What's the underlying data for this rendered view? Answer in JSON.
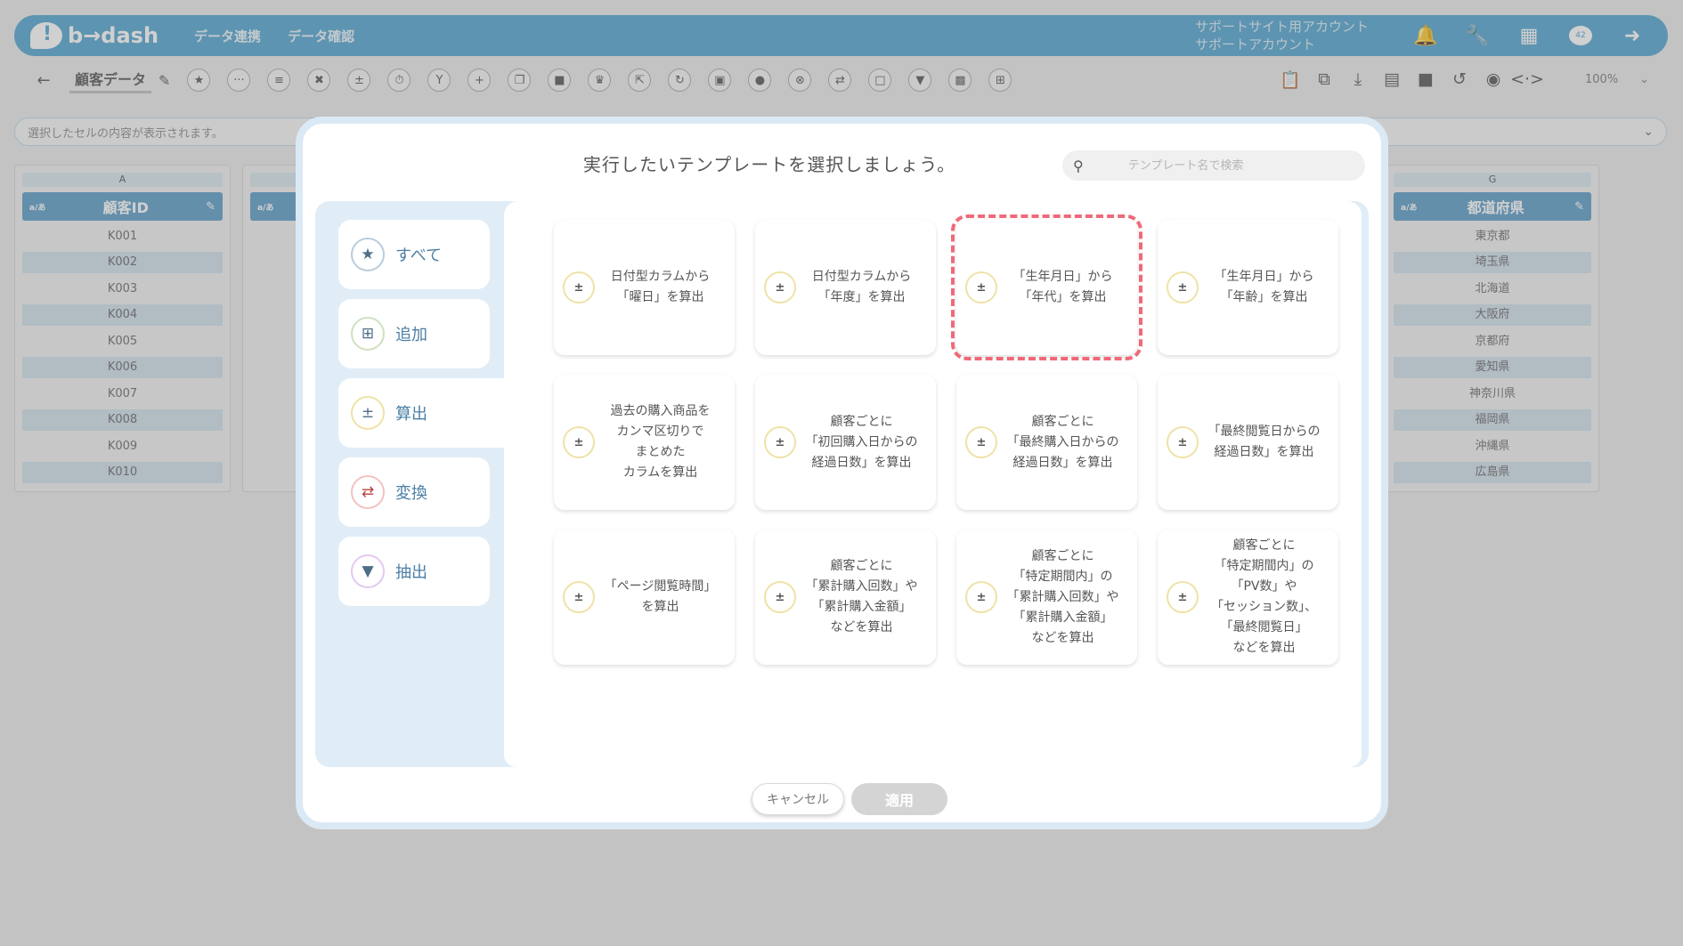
{
  "header": {
    "logo_text": "b→dash",
    "nav": [
      "データ連携",
      "データ確認"
    ],
    "account_line1": "サポートサイト用アカウント",
    "account_line2": "サポートアカウント",
    "badge_count": "42"
  },
  "toolbar": {
    "sheet_title": "顧客データ",
    "zoom": "100%"
  },
  "formula_bar": {
    "placeholder": "選択したセルの内容が表示されます。"
  },
  "columns": [
    {
      "letter": "A",
      "header": "顧客ID",
      "type_label": "a/あ",
      "cells": [
        "K001",
        "K002",
        "K003",
        "K004",
        "K005",
        "K006",
        "K007",
        "K008",
        "K009",
        "K010"
      ]
    },
    {
      "letter": "G",
      "header": "都道府県",
      "type_label": "a/あ",
      "cells": [
        "東京都",
        "埼玉県",
        "北海道",
        "大阪府",
        "京都府",
        "愛知県",
        "神奈川県",
        "福岡県",
        "沖縄県",
        "広島県"
      ]
    }
  ],
  "col_b": {
    "type_label": "a/あ"
  },
  "modal": {
    "title": "実行したいテンプレートを選択しましょう。",
    "search_placeholder": "テンプレート名で検索",
    "categories": [
      {
        "label": "すべて",
        "icon": "star-icon"
      },
      {
        "label": "追加",
        "icon": "plus-square-icon"
      },
      {
        "label": "算出",
        "icon": "calculation-icon"
      },
      {
        "label": "変換",
        "icon": "convert-icon"
      },
      {
        "label": "抽出",
        "icon": "filter-icon"
      }
    ],
    "active_category": "算出",
    "templates": [
      {
        "label": "日付型カラムから\n「曜日」を算出"
      },
      {
        "label": "日付型カラムから\n「年度」を算出"
      },
      {
        "label": "「生年月日」から\n「年代」を算出"
      },
      {
        "label": "「生年月日」から\n「年齢」を算出"
      },
      {
        "label": "過去の購入商品を\nカンマ区切りで\nまとめた\nカラムを算出"
      },
      {
        "label": "顧客ごとに\n「初回購入日からの\n経過日数」を算出"
      },
      {
        "label": "顧客ごとに\n「最終購入日からの\n経過日数」を算出"
      },
      {
        "label": "「最終閲覧日からの\n経過日数」を算出"
      },
      {
        "label": "「ページ閲覧時間」\nを算出"
      },
      {
        "label": "顧客ごとに\n「累計購入回数」や\n「累計購入金額」\nなどを算出"
      },
      {
        "label": "顧客ごとに\n「特定期間内」の\n「累計購入回数」や\n「累計購入金額」\nなどを算出"
      },
      {
        "label": "顧客ごとに\n「特定期間内」の\n「PV数」や\n「セッション数」、\n「最終閲覧日」\nなどを算出"
      }
    ],
    "highlighted_index": 2,
    "highlight_color": "#ef6a78",
    "cancel_label": "キャンセル",
    "apply_label": "適用"
  },
  "colors": {
    "header_bg": "#4fa3d0",
    "column_header_bg": "#5a9cc6",
    "panel_bg": "#e0edf7"
  }
}
